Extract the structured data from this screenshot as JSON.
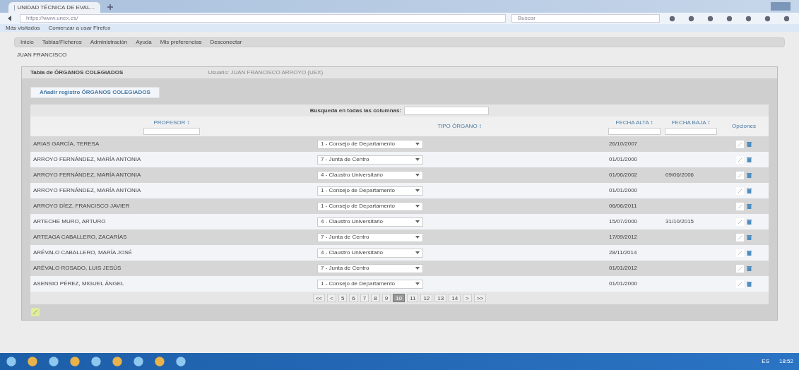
{
  "browser": {
    "tab_title": "UNIDAD TÉCNICA DE EVAL...",
    "url": "https://www.unex.es/",
    "search_placeholder": "Buscar",
    "bookmarks": [
      "Más visitados",
      "Comenzar a usar Firefox"
    ]
  },
  "menu": [
    {
      "label": "Inicio"
    },
    {
      "label": "Tablas/Ficheros"
    },
    {
      "label": "Administración"
    },
    {
      "label": "Ayuda"
    },
    {
      "label": "Mis preferencias"
    },
    {
      "label": "Desconectar"
    }
  ],
  "user": "JUAN FRANCISCO",
  "panel": {
    "title": "Tabla de ÓRGANOS COLEGIADOS",
    "session": "Usuario: JUAN FRANCISCO ARROYO (UEX)",
    "add_button": "Añadir registro ÓRGANOS COLEGIADOS"
  },
  "table": {
    "search_label": "Búsqueda en todas las columnas:",
    "columns": [
      {
        "label": "PROFESOR ↕",
        "filter": true
      },
      {
        "label": "TIPO ÓRGANO ↕",
        "filter": false
      },
      {
        "label": "FECHA ALTA ↕",
        "filter": true
      },
      {
        "label": "FECHA BAJA ↕",
        "filter": true
      },
      {
        "label": "Opciones",
        "filter": false
      }
    ],
    "rows": [
      {
        "profesor": "ARIAS GARCÍA, TERESA",
        "organo": "1 - Consejo de Departamento",
        "alta": "26/10/2007",
        "baja": ""
      },
      {
        "profesor": "ARROYO FERNÁNDEZ, MARÍA ANTONIA",
        "organo": "7 - Junta de Centro",
        "alta": "01/01/2000",
        "baja": ""
      },
      {
        "profesor": "ARROYO FERNÁNDEZ, MARÍA ANTONIA",
        "organo": "4 - Claustro Universitario",
        "alta": "01/06/2002",
        "baja": "09/06/2006"
      },
      {
        "profesor": "ARROYO FERNÁNDEZ, MARÍA ANTONIA",
        "organo": "1 - Consejo de Departamento",
        "alta": "01/01/2000",
        "baja": ""
      },
      {
        "profesor": "ARROYO DÍEZ, FRANCISCO JAVIER",
        "organo": "1 - Consejo de Departamento",
        "alta": "06/06/2011",
        "baja": ""
      },
      {
        "profesor": "ARTECHE MURO, ARTURO",
        "organo": "4 - Claustro Universitario",
        "alta": "15/07/2000",
        "baja": "31/10/2015"
      },
      {
        "profesor": "ARTEAGA CABALLERO, ZACARÍAS",
        "organo": "7 - Junta de Centro",
        "alta": "17/09/2012",
        "baja": ""
      },
      {
        "profesor": "ARÉVALO CABALLERO, MARÍA JOSÉ",
        "organo": "4 - Claustro Universitario",
        "alta": "28/11/2014",
        "baja": ""
      },
      {
        "profesor": "ARÉVALO ROSADO, LUIS JESÚS",
        "organo": "7 - Junta de Centro",
        "alta": "01/01/2012",
        "baja": ""
      },
      {
        "profesor": "ASENSIO PÉREZ, MIGUEL ÁNGEL",
        "organo": "1 - Consejo de Departamento",
        "alta": "01/01/2000",
        "baja": ""
      }
    ],
    "pagination": [
      {
        "label": "<<",
        "selected": false
      },
      {
        "label": "<",
        "selected": false
      },
      {
        "label": "5",
        "selected": false
      },
      {
        "label": "6",
        "selected": false
      },
      {
        "label": "7",
        "selected": false
      },
      {
        "label": "8",
        "selected": false
      },
      {
        "label": "9",
        "selected": false
      },
      {
        "label": "10",
        "selected": true
      },
      {
        "label": "11",
        "selected": false
      },
      {
        "label": "12",
        "selected": false
      },
      {
        "label": "13",
        "selected": false
      },
      {
        "label": "14",
        "selected": false
      },
      {
        "label": ">",
        "selected": false
      },
      {
        "label": ">>",
        "selected": false
      }
    ]
  },
  "taskbar": {
    "language": "ES",
    "time": "18:52"
  }
}
